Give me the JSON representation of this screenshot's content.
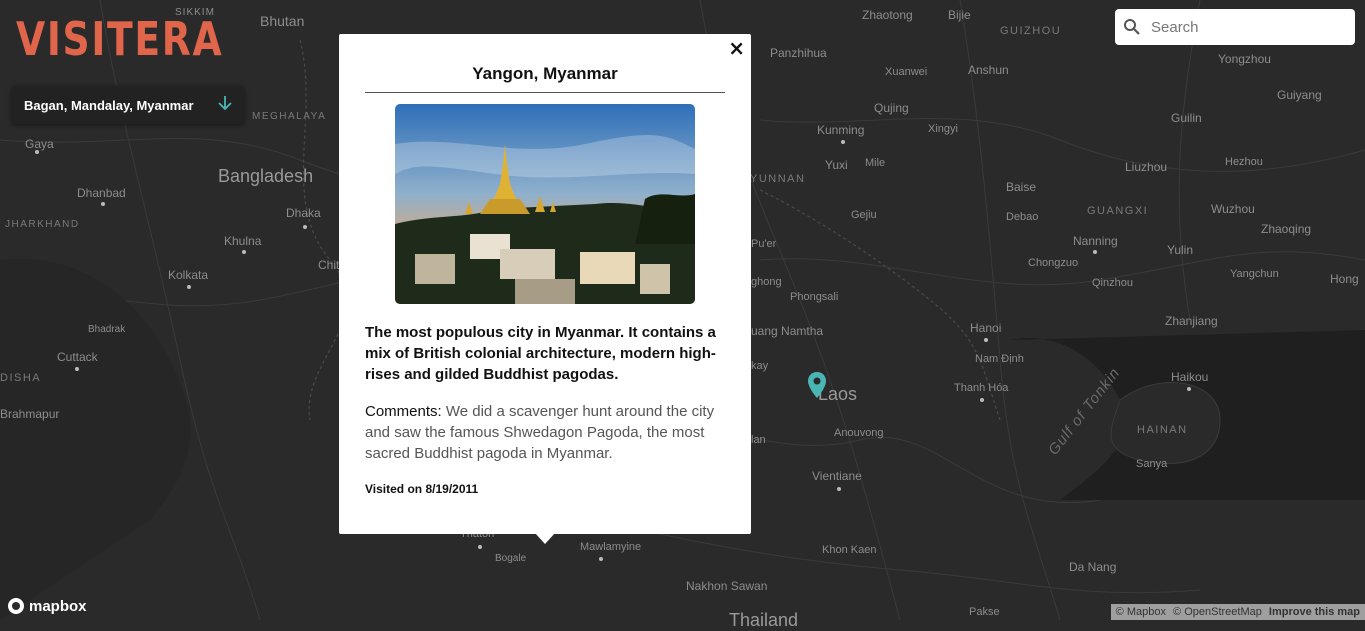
{
  "app": {
    "logo_text": "VISITERA"
  },
  "location_select": {
    "value": "Bagan, Mandalay, Myanmar",
    "arrow_icon": "arrow-down-icon"
  },
  "search": {
    "placeholder": "Search",
    "icon": "search-icon"
  },
  "popup": {
    "title": "Yangon, Myanmar",
    "image_alt": "Shwedagon Pagoda at sunset over Yangon",
    "description": "The most populous city in Myanmar. It contains a mix of British colonial architecture, modern high-rises and gilded Buddhist pagodas.",
    "comments_label": "Comments:",
    "comments_text": "We did a scavenger hunt around the city and saw the famous Shwedagon Pagoda, the most sacred Buddhist pagoda in Myanmar.",
    "visited": "Visited on 8/19/2011",
    "close_symbol": "×"
  },
  "map_labels": {
    "sikkim": "SIKKIM",
    "bhutan": "Bhutan",
    "meghalaya": "MEGHALAYA",
    "gaya": "Gaya",
    "bangladesh": "Bangladesh",
    "dhanbad": "Dhanbad",
    "dhaka": "Dhaka",
    "jharkhand": "JHARKHAND",
    "khulna": "Khulna",
    "chit": "Chit",
    "kolkata": "Kolkata",
    "bhadrak": "Bhadrak",
    "cuttack": "Cuttack",
    "disha": "DISHA",
    "brahmapur": "Brahmapur",
    "zhaotong": "Zhaotong",
    "bijie": "Bijie",
    "guizhou": "GUIZHOU",
    "yongzhou": "Yongzhou",
    "panzhihua": "Panzhihua",
    "anshun": "Anshun",
    "xuanwei": "Xuanwei",
    "guiyang": "Guiyang",
    "qujing": "Qujing",
    "guilin": "Guilin",
    "kunming": "Kunming",
    "xingyi": "Xingyi",
    "yuxi": "Yuxi",
    "mile": "Mile",
    "liuzhou": "Liuzhou",
    "hezhou": "Hezhou",
    "yunnan": "YUNNAN",
    "baise": "Baise",
    "debao": "Debao",
    "guangxi": "GUANGXI",
    "wuzhou": "Wuzhou",
    "gejiu": "Gejiu",
    "nanning": "Nanning",
    "zhaoqing": "Zhaoqing",
    "puer": "Pu'er",
    "yulin": "Yulin",
    "chongzuo": "Chongzuo",
    "yangchun": "Yangchun",
    "hong": "Hong",
    "jinghong": "ghong",
    "phongsali": "Phongsali",
    "qinzhou": "Qinzhou",
    "zhanjiang": "Zhanjiang",
    "luangnamtha": "uang Namtha",
    "hanoi": "Hanoi",
    "namdinh": "Nam Định",
    "gulf": "Gulf of Tonkin",
    "kay": "kay",
    "laos": "Laos",
    "thanhhoa": "Thanh Hóa",
    "haikou": "Haikou",
    "hainan": "HAINAN",
    "anouvong": "Anouvong",
    "lan": "lan",
    "sanya": "Sanya",
    "vientiane": "Vientiane",
    "thaton": "Thaton",
    "mawlamyine": "Mawlamyine",
    "bogale": "Bogale",
    "khonkaen": "Khon Kaen",
    "danang": "Da Nang",
    "nakhonsawan": "Nakhon Sawan",
    "pakse": "Pakse",
    "thailand": "Thailand"
  },
  "footer": {
    "mapbox_logo": "mapbox",
    "attribution_mapbox": "© Mapbox",
    "attribution_osm": "© OpenStreetMap",
    "improve": "Improve this map"
  },
  "colors": {
    "accent": "#e0654a",
    "marker": "#4ab5b5",
    "map_bg": "#2a2a2a"
  }
}
